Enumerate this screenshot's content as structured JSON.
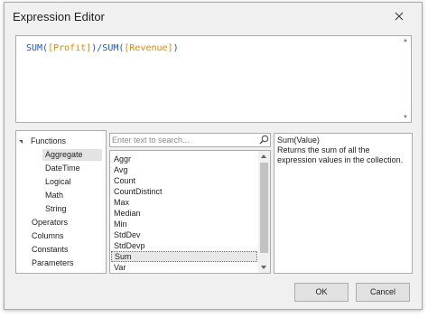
{
  "window": {
    "title": "Expression Editor"
  },
  "editor": {
    "fn1": "SUM(",
    "field1": "[Profit]",
    "sep": ")/SUM(",
    "field2": "[Revenue]",
    "close": ")"
  },
  "tree": {
    "items": [
      {
        "label": "Functions",
        "level": 0,
        "expanded": true
      },
      {
        "label": "Aggregate",
        "level": 1,
        "selected": true
      },
      {
        "label": "DateTime",
        "level": 1
      },
      {
        "label": "Logical",
        "level": 1
      },
      {
        "label": "Math",
        "level": 1
      },
      {
        "label": "String",
        "level": 1
      },
      {
        "label": "Operators",
        "level": 0
      },
      {
        "label": "Columns",
        "level": 0
      },
      {
        "label": "Constants",
        "level": 0
      },
      {
        "label": "Parameters",
        "level": 0
      }
    ]
  },
  "search": {
    "placeholder": "Enter text to search...",
    "value": ""
  },
  "functions": {
    "items": [
      "Aggr",
      "Avg",
      "Count",
      "CountDistinct",
      "Max",
      "Median",
      "Min",
      "StdDev",
      "StdDevp",
      "Sum",
      "Var"
    ],
    "selected": "Sum"
  },
  "description": {
    "title": "Sum(Value)",
    "text": "Returns the sum of all the expression values in the collection."
  },
  "buttons": {
    "ok": "OK",
    "cancel": "Cancel"
  },
  "colors": {
    "function": "#1c57c2",
    "field": "#e08a00",
    "background": "#f0f0f0"
  }
}
